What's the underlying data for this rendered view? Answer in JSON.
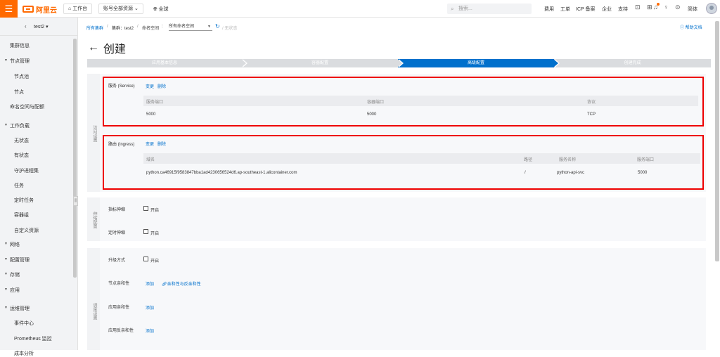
{
  "topbar": {
    "menu_icon": "menu-icon",
    "logo_text": "阿里云",
    "workbench": "工作台",
    "account_resources": "账号全部资源",
    "region": "全球",
    "search_placeholder": "搜索...",
    "nav": [
      "费用",
      "工单",
      "ICP 备案",
      "企业",
      "支持"
    ],
    "lang": "简体"
  },
  "sidebar": {
    "cluster": "test2",
    "items": [
      {
        "label": "集群信息",
        "indent": false,
        "tri": false
      },
      {
        "label": "节点管理",
        "indent": false,
        "tri": true
      },
      {
        "label": "节点池",
        "indent": true,
        "tri": false
      },
      {
        "label": "节点",
        "indent": true,
        "tri": false
      },
      {
        "label": "命名空间与配额",
        "indent": false,
        "tri": false
      },
      {
        "label": "工作负载",
        "indent": false,
        "tri": true
      },
      {
        "label": "无状态",
        "indent": true,
        "tri": false
      },
      {
        "label": "有状态",
        "indent": true,
        "tri": false
      },
      {
        "label": "守护进程集",
        "indent": true,
        "tri": false
      },
      {
        "label": "任务",
        "indent": true,
        "tri": false
      },
      {
        "label": "定时任务",
        "indent": true,
        "tri": false
      },
      {
        "label": "容器组",
        "indent": true,
        "tri": false
      },
      {
        "label": "自定义资源",
        "indent": true,
        "tri": false
      },
      {
        "label": "网络",
        "indent": false,
        "tri": true
      },
      {
        "label": "配置管理",
        "indent": false,
        "tri": true
      },
      {
        "label": "存储",
        "indent": false,
        "tri": true
      },
      {
        "label": "应用",
        "indent": false,
        "tri": true
      },
      {
        "label": "运维管理",
        "indent": false,
        "tri": true
      },
      {
        "label": "事件中心",
        "indent": true,
        "tri": false
      },
      {
        "label": "Prometheus 监控",
        "indent": true,
        "tri": false
      },
      {
        "label": "成本分析",
        "indent": true,
        "tri": false
      }
    ]
  },
  "breadcrumb": {
    "all_clusters": "所有集群",
    "cluster_label": "集群：test2",
    "namespace_label": "命名空间",
    "namespace_value": "所有命名空间",
    "stateless": "无状态"
  },
  "help": "帮助文档",
  "page_title": "创建",
  "steps": [
    "应用基本信息",
    "容器配置",
    "高级配置",
    "创建完成"
  ],
  "access_section": "访问设置",
  "service": {
    "label": "服务 (Service)",
    "edit": "变更",
    "delete": "删除",
    "headers": [
      "服务端口",
      "容器端口",
      "协议"
    ],
    "row": [
      "5000",
      "5000",
      "TCP"
    ]
  },
  "ingress": {
    "label": "路由 (Ingress)",
    "edit": "变更",
    "delete": "删除",
    "headers": [
      "域名",
      "路径",
      "服务名称",
      "服务端口"
    ],
    "row": [
      "python.ca46915f9583847bba1ad4230656524d6.ap-southeast-1.alicontainer.com",
      "/",
      "python-api-svc",
      "5000"
    ]
  },
  "scaling_section": "伸缩配置",
  "hpa": {
    "label": "指标伸缩",
    "checkbox": "开启"
  },
  "cron_hpa": {
    "label": "定时伸缩",
    "checkbox": "开启"
  },
  "scheduling_section": "调度设置",
  "upgrade": {
    "label": "升级方式",
    "checkbox": "开启"
  },
  "node_affinity": {
    "label": "节点亲和性",
    "add": "添加",
    "link": "亲和性与反亲和性"
  },
  "app_affinity": {
    "label": "应用亲和性",
    "add": "添加"
  },
  "app_anti_affinity": {
    "label": "应用反亲和性",
    "add": "添加"
  },
  "colors": {
    "brand": "#ff6a00",
    "primary": "#0070cc",
    "highlight": "#e00000"
  }
}
